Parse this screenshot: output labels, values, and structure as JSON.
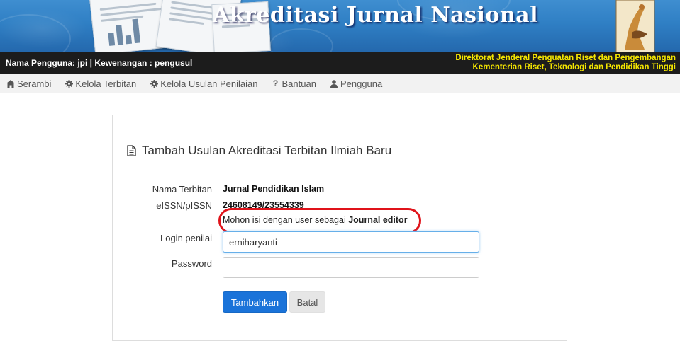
{
  "banner": {
    "title": "Akreditasi Jurnal Nasional",
    "colors": {
      "sky": "#2f7fc4",
      "title_text": "#ffffff"
    }
  },
  "infobar": {
    "user_info": "Nama Pengguna: jpi | Kewenangan : pengusul",
    "org_line1": "Direktorat Jenderal Penguatan Riset dan Pengembangan",
    "org_line2": "Kementerian Riset, Teknologi dan Pendidikan Tinggi",
    "colors": {
      "background": "#1c1c1c",
      "org_text": "#f5e600"
    }
  },
  "nav": {
    "items": [
      {
        "icon": "home-icon",
        "label": "Serambi"
      },
      {
        "icon": "gear-icon",
        "label": "Kelola Terbitan"
      },
      {
        "icon": "gear-icon",
        "label": "Kelola Usulan Penilaian"
      },
      {
        "icon": "question-icon",
        "label": "Bantuan"
      },
      {
        "icon": "user-icon",
        "label": "Pengguna"
      }
    ]
  },
  "form": {
    "title": "Tambah Usulan Akreditasi Terbitan Ilmiah Baru",
    "title_icon": "document-icon",
    "fields": {
      "nama_terbitan": {
        "label": "Nama Terbitan",
        "value": "Jurnal Pendidikan Islam"
      },
      "issn": {
        "label": "eISSN/pISSN",
        "value": "24608149/23554339"
      },
      "hint_text": "Mohon isi dengan user sebagai ",
      "hint_bold": "Journal editor",
      "login": {
        "label": "Login penilai",
        "value": "erniharyanti",
        "placeholder": ""
      },
      "password": {
        "label": "Password",
        "value": "",
        "placeholder": ""
      }
    },
    "buttons": {
      "submit": "Tambahkan",
      "cancel": "Batal"
    },
    "colors": {
      "primary": "#1a73d9",
      "highlight_oval": "#e0131a",
      "focus_border": "#66afe9"
    }
  }
}
